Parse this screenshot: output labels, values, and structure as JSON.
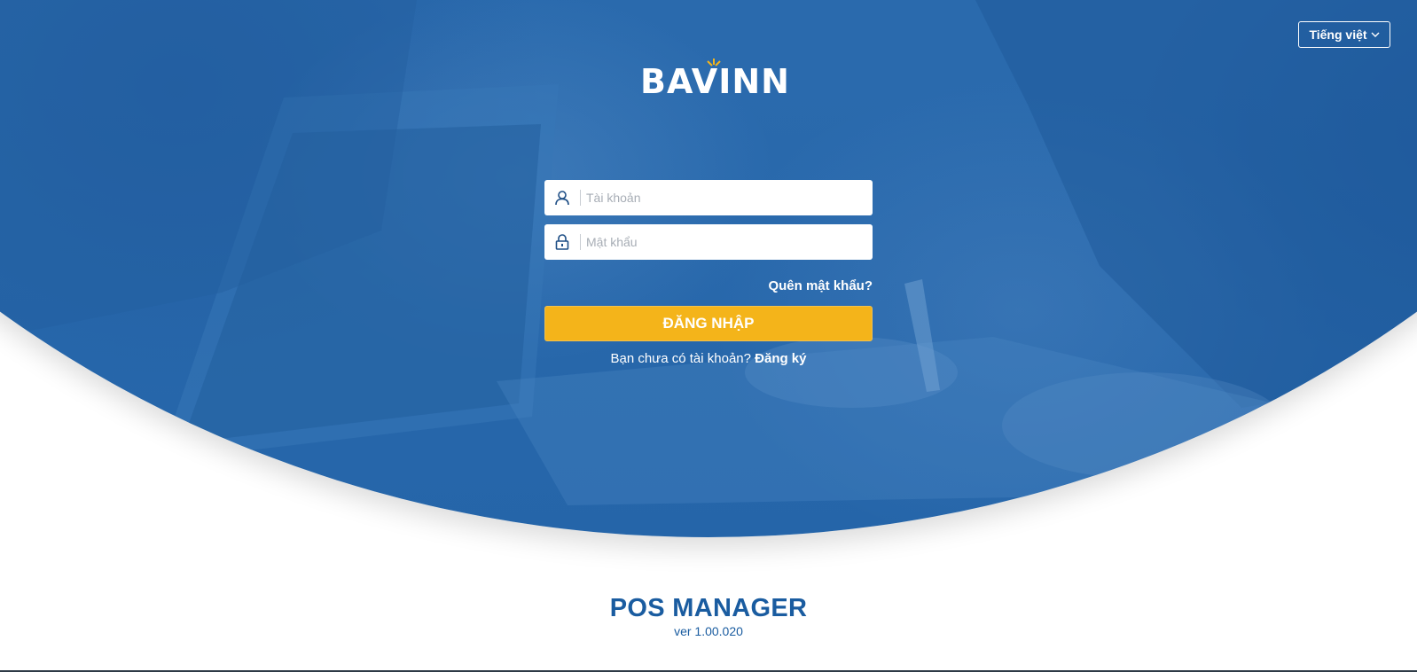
{
  "colors": {
    "brand_blue": "#2a6aad",
    "accent_yellow": "#f4b41a",
    "title_blue": "#1a5ca0"
  },
  "header": {
    "language_label": "Tiếng việt",
    "language_icon": "chevron-down-icon"
  },
  "brand": {
    "logo_text": "BAVINN"
  },
  "login_form": {
    "username_placeholder": "Tài khoản",
    "username_icon": "user-icon",
    "password_placeholder": "Mật khẩu",
    "password_icon": "lock-icon",
    "forgot_password": "Quên mật khẩu?",
    "login_button": "ĐĂNG NHẬP",
    "no_account_text": "Bạn chưa có tài khoản?",
    "register_link": "Đăng ký"
  },
  "footer": {
    "app_name": "POS MANAGER",
    "version": "ver 1.00.020"
  }
}
